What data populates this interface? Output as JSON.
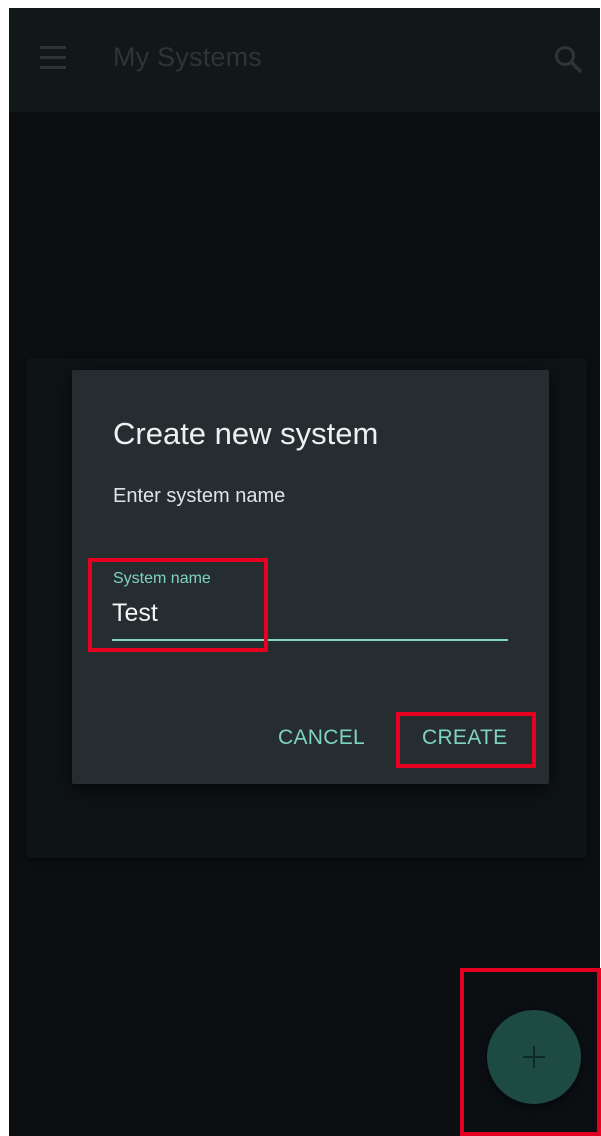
{
  "app_bar": {
    "title": "My Systems",
    "menu_icon": "hamburger-menu-icon",
    "search_icon": "search-icon"
  },
  "dialog": {
    "title": "Create new system",
    "message": "Enter system name",
    "field": {
      "label": "System name",
      "value": "Test"
    },
    "cancel_label": "CANCEL",
    "create_label": "CREATE"
  },
  "fab": {
    "icon": "plus-icon",
    "label": "+"
  },
  "colors": {
    "accent": "#7fd3c3",
    "background": "#0b0f12",
    "dialog_background": "#262d31",
    "fab_background": "#1d4a43",
    "annotation_highlight": "#e6001f"
  }
}
